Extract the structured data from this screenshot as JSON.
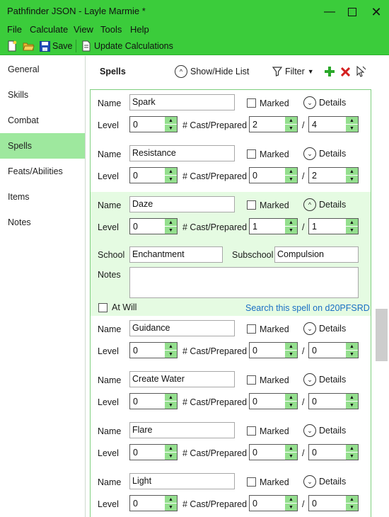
{
  "window": {
    "title": "Pathfinder JSON - Layle Marmie *",
    "controls": [
      "minimize-icon",
      "maximize-icon",
      "close-icon"
    ]
  },
  "menu": {
    "items": [
      "File",
      "Calculate",
      "View",
      "Tools",
      "Help"
    ]
  },
  "toolbar": {
    "save_label": "Save",
    "update_label": "Update Calculations",
    "icons": [
      "new-file-icon",
      "open-folder-icon",
      "save-icon",
      "update-icon"
    ]
  },
  "sidebar": {
    "items": [
      "General",
      "Skills",
      "Combat",
      "Spells",
      "Feats/Abilities",
      "Items",
      "Notes"
    ],
    "active": "Spells"
  },
  "spells_header": {
    "title": "Spells",
    "show_hide_label": "Show/Hide List",
    "filter_label": "Filter",
    "icons": [
      "add-icon",
      "delete-icon",
      "cursor-icon"
    ]
  },
  "labels": {
    "name": "Name",
    "level": "Level",
    "cast_prepared": "# Cast/Prepared",
    "marked": "Marked",
    "details": "Details",
    "slash": "/",
    "school": "School",
    "subschool": "Subschool",
    "notes": "Notes",
    "at_will": "At Will",
    "search_link": "Search this spell on d20PFSRD"
  },
  "spells": [
    {
      "name": "Spark",
      "level": "0",
      "cast": "2",
      "prepared": "4",
      "expanded": false
    },
    {
      "name": "Resistance",
      "level": "0",
      "cast": "0",
      "prepared": "2",
      "expanded": false
    },
    {
      "name": "Daze",
      "level": "0",
      "cast": "1",
      "prepared": "1",
      "expanded": true,
      "school": "Enchantment",
      "subschool": "Compulsion",
      "notes": ""
    },
    {
      "name": "Guidance",
      "level": "0",
      "cast": "0",
      "prepared": "0",
      "expanded": false
    },
    {
      "name": "Create Water",
      "level": "0",
      "cast": "0",
      "prepared": "0",
      "expanded": false
    },
    {
      "name": "Flare",
      "level": "0",
      "cast": "0",
      "prepared": "0",
      "expanded": false
    },
    {
      "name": "Light",
      "level": "0",
      "cast": "0",
      "prepared": "0",
      "expanded": false
    }
  ],
  "colors": {
    "accent": "#3bcc3b",
    "sidebar_active": "#9ee89e",
    "selected_row": "#e5fbe2",
    "spinner": "#94df8e",
    "link": "#1a6fc4",
    "delete": "#d42020",
    "add": "#2aa82a"
  }
}
